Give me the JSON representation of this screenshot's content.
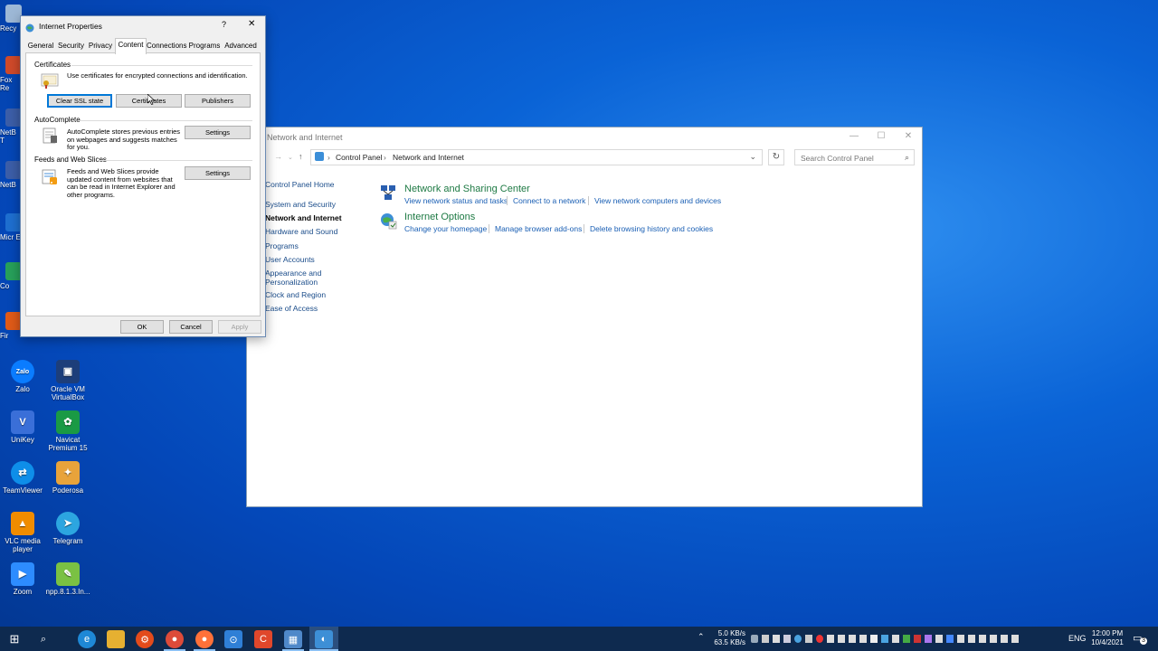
{
  "desktop": {
    "icons": [
      {
        "label": "Zalo",
        "color": "#0a7cff",
        "glyph": "Zalo"
      },
      {
        "label": "Oracle VM VirtualBox",
        "color": "#1d3e7a",
        "glyph": "▣"
      },
      {
        "label": "UniKey",
        "color": "#3a6fd8",
        "glyph": "V"
      },
      {
        "label": "Navicat Premium 15",
        "color": "#1a9a45",
        "glyph": "✿"
      },
      {
        "label": "TeamViewer",
        "color": "#0e8ee9",
        "glyph": "⇄"
      },
      {
        "label": "Poderosa",
        "color": "#e8a33b",
        "glyph": "✦"
      },
      {
        "label": "VLC media player",
        "color": "#f08c00",
        "glyph": "▲"
      },
      {
        "label": "Telegram",
        "color": "#2ca5e0",
        "glyph": "➤"
      },
      {
        "label": "Zoom",
        "color": "#2d8cff",
        "glyph": "▶"
      },
      {
        "label": "npp.8.1.3.In...",
        "color": "#7ac143",
        "glyph": "✎"
      }
    ],
    "partial_labels": [
      "Recy",
      "Fox Re",
      "NetB T",
      "NetB",
      "Micr E",
      "Co",
      "Fir"
    ]
  },
  "control_panel": {
    "title": "Network and Internet",
    "address": {
      "root": "Control Panel",
      "current": "Network and Internet"
    },
    "search_placeholder": "Search Control Panel",
    "sidebar": [
      {
        "label": "Control Panel Home",
        "current": false
      },
      {
        "label": "System and Security",
        "current": false
      },
      {
        "label": "Network and Internet",
        "current": true
      },
      {
        "label": "Hardware and Sound",
        "current": false
      },
      {
        "label": "Programs",
        "current": false
      },
      {
        "label": "User Accounts",
        "current": false
      },
      {
        "label": "Appearance and Personalization",
        "current": false
      },
      {
        "label": "Clock and Region",
        "current": false
      },
      {
        "label": "Ease of Access",
        "current": false
      }
    ],
    "categories": [
      {
        "title": "Network and Sharing Center",
        "links": [
          "View network status and tasks",
          "Connect to a network",
          "View network computers and devices"
        ]
      },
      {
        "title": "Internet Options",
        "links": [
          "Change your homepage",
          "Manage browser add-ons",
          "Delete browsing history and cookies"
        ]
      }
    ]
  },
  "internet_properties": {
    "title": "Internet Properties",
    "help": "?",
    "close": "✕",
    "tabs": [
      "General",
      "Security",
      "Privacy",
      "Content",
      "Connections",
      "Programs",
      "Advanced"
    ],
    "active_tab": "Content",
    "certificates": {
      "header": "Certificates",
      "desc": "Use certificates for encrypted connections and identification.",
      "buttons": [
        "Clear SSL state",
        "Certificates",
        "Publishers"
      ]
    },
    "autocomplete": {
      "header": "AutoComplete",
      "desc": "AutoComplete stores previous entries on webpages and suggests matches for you.",
      "button": "Settings"
    },
    "feeds": {
      "header": "Feeds and Web Slices",
      "desc": "Feeds and Web Slices provide updated content from websites that can be read in Internet Explorer and other programs.",
      "button": "Settings"
    },
    "footer": [
      "OK",
      "Cancel",
      "Apply"
    ]
  },
  "taskbar": {
    "net_up": "5.0 KB/s",
    "net_down": "63.5 KB/s",
    "lang": "ENG",
    "time": "12:00 PM",
    "date": "10/4/2021",
    "notif_count": "3"
  }
}
